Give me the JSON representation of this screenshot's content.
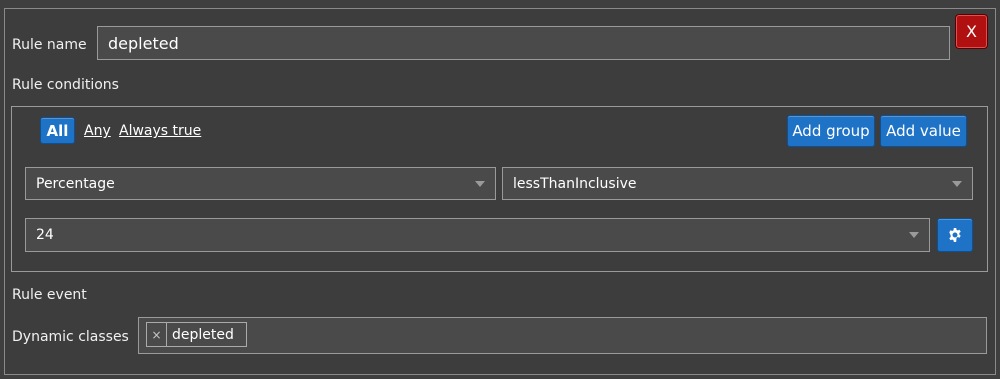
{
  "rule": {
    "name_label": "Rule name",
    "name_value": "depleted",
    "close_label": "X"
  },
  "conditions": {
    "title": "Rule conditions",
    "all_label": "All",
    "any_label": "Any",
    "always_true_label": "Always true",
    "add_group_label": "Add group",
    "add_value_label": "Add value",
    "fact_value": "Percentage",
    "operator_value": "lessThanInclusive",
    "value_value": "24",
    "settings_icon": "gear-icon"
  },
  "event": {
    "title": "Rule event",
    "dynamic_classes_label": "Dynamic classes",
    "tags": [
      {
        "remove": "×",
        "label": "depleted"
      }
    ]
  },
  "colors": {
    "background": "#3f3f3f",
    "accent_blue": "#1e73c7",
    "danger_red": "#b0100f"
  }
}
